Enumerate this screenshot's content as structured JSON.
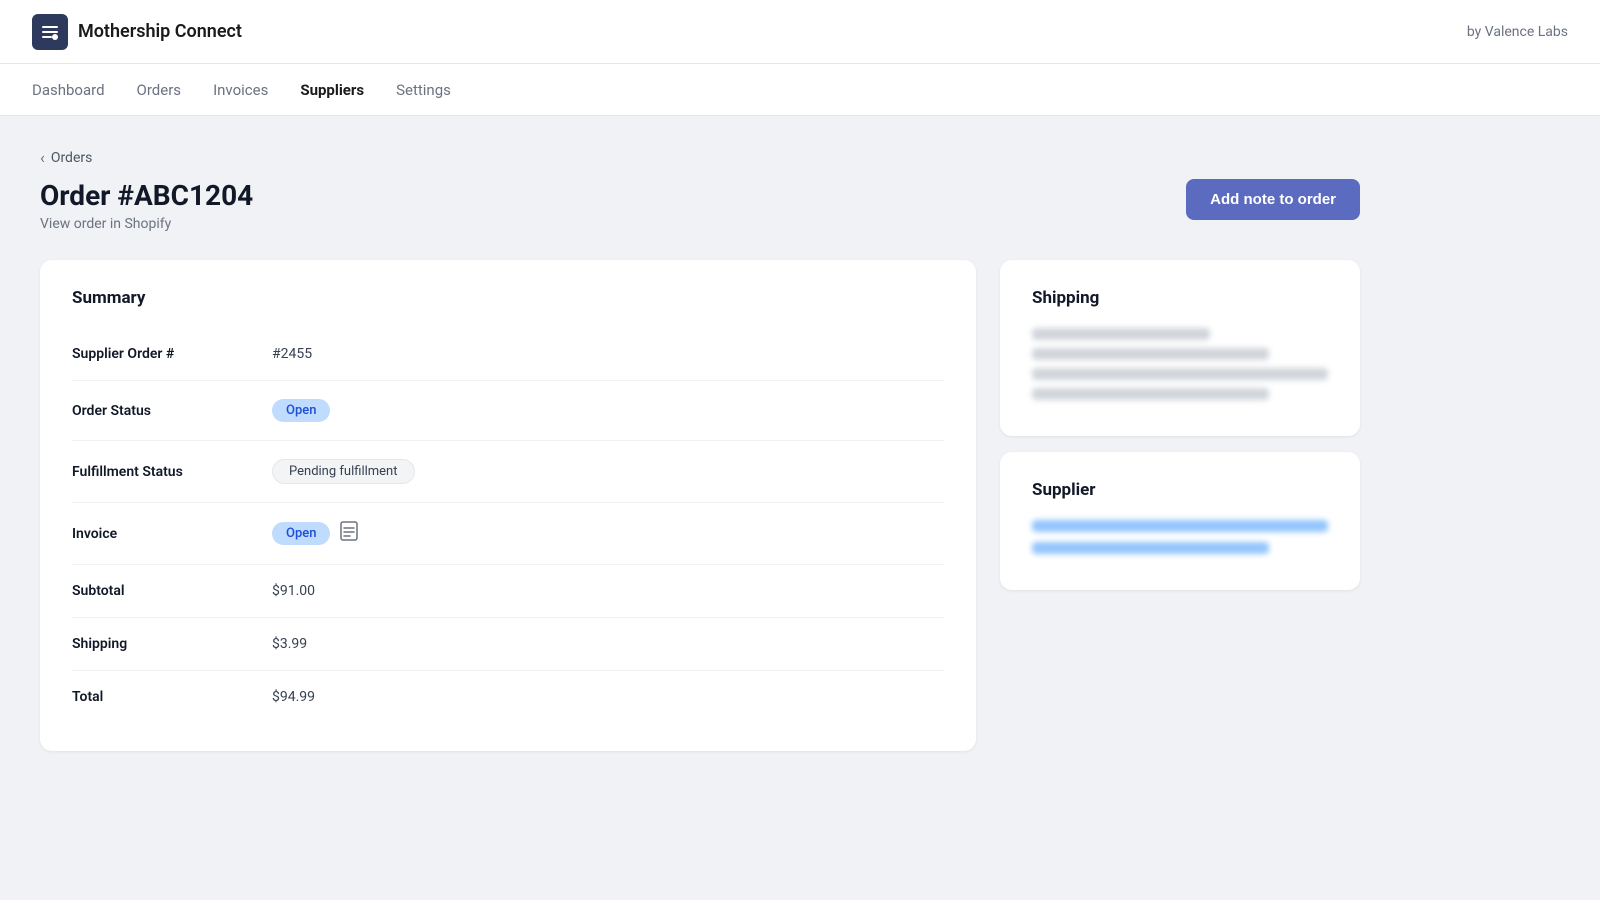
{
  "app": {
    "brand_name": "Mothership Connect",
    "by_label": "by Valence Labs",
    "brand_icon": "✦"
  },
  "nav": {
    "items": [
      {
        "label": "Dashboard",
        "active": false
      },
      {
        "label": "Orders",
        "active": false
      },
      {
        "label": "Invoices",
        "active": false
      },
      {
        "label": "Suppliers",
        "active": true
      },
      {
        "label": "Settings",
        "active": false
      }
    ]
  },
  "breadcrumb": {
    "back_label": "Orders"
  },
  "page": {
    "title": "Order #ABC1204",
    "subtitle": "View order in Shopify",
    "add_note_button": "Add note to order"
  },
  "summary": {
    "section_title": "Summary",
    "rows": [
      {
        "label": "Supplier Order #",
        "value": "#2455",
        "type": "text"
      },
      {
        "label": "Order Status",
        "value": "Open",
        "type": "badge-open"
      },
      {
        "label": "Fulfillment Status",
        "value": "Pending fulfillment",
        "type": "badge-pending"
      },
      {
        "label": "Invoice",
        "value": "Open",
        "type": "badge-open-invoice"
      },
      {
        "label": "Subtotal",
        "value": "$91.00",
        "type": "text"
      },
      {
        "label": "Shipping",
        "value": "$3.99",
        "type": "text"
      },
      {
        "label": "Total",
        "value": "$94.99",
        "type": "text"
      }
    ]
  },
  "shipping": {
    "section_title": "Shipping"
  },
  "supplier": {
    "section_title": "Supplier"
  }
}
